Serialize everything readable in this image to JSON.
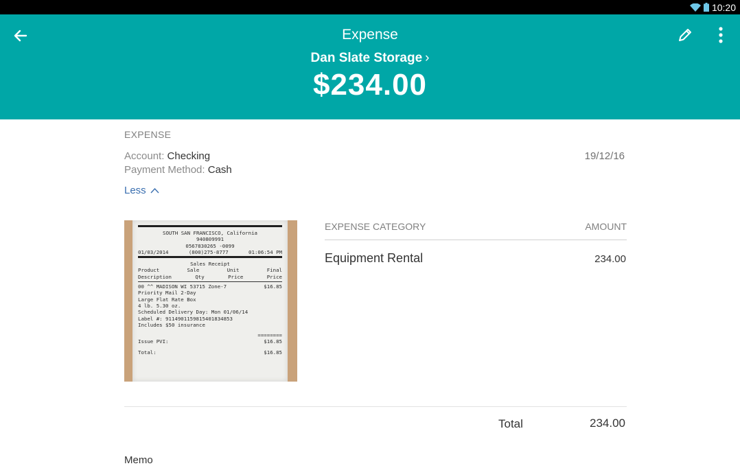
{
  "status_bar": {
    "time": "10:20",
    "icons": [
      "wifi-icon",
      "battery-icon"
    ]
  },
  "header": {
    "title": "Expense",
    "payee": "Dan Slate Storage",
    "amount": "$234.00",
    "icons": {
      "back": "arrow-left-icon",
      "edit": "pencil-icon",
      "more": "more-vertical-icon"
    },
    "background_color": "#00a7a7"
  },
  "details": {
    "section_label": "EXPENSE",
    "account_label": "Account:",
    "account_value": "Checking",
    "payment_method_label": "Payment Method:",
    "payment_method_value": "Cash",
    "date": "19/12/16",
    "less_label": "Less"
  },
  "receipt": {
    "lines": {
      "city": "SOUTH SAN FRANCISCO, California",
      "id1": "940809991",
      "id2": "0567830265 -0099",
      "date": "01/03/2014",
      "phone": "(800)275-8777",
      "time": "01:06:54 PM",
      "title": "Sales Receipt",
      "col_product": "Product",
      "col_sale": "Sale",
      "col_unit": "Unit",
      "col_final": "Final",
      "col_description": "Description",
      "col_qty": "Qty",
      "col_price": "Price",
      "col_price2": "Price",
      "item1": "00 ^^ MADISON WI 53715 Zone-7",
      "item1_price": "$16.85",
      "item2": "Priority Mail 2-Day",
      "item3": "Large Flat Rate Box",
      "item4": "4 lb.  5.30 oz.",
      "item5": "Scheduled Delivery Day: Mon 01/06/14",
      "item6": "Label #: 9114901159815401834853",
      "item7": "Includes $50 insurance",
      "equals": "========",
      "issue_label": "Issue PVI:",
      "issue_value": "$16.85",
      "total_label": "Total:",
      "total_value": "$16.85"
    }
  },
  "categories": {
    "category_header": "EXPENSE CATEGORY",
    "amount_header": "AMOUNT",
    "rows": [
      {
        "name": "Equipment Rental",
        "amount": "234.00"
      }
    ]
  },
  "totals": {
    "label": "Total",
    "value": "234.00"
  },
  "memo": {
    "label": "Memo"
  },
  "colors": {
    "accent": "#00a7a7",
    "link": "#3a6fb0"
  }
}
